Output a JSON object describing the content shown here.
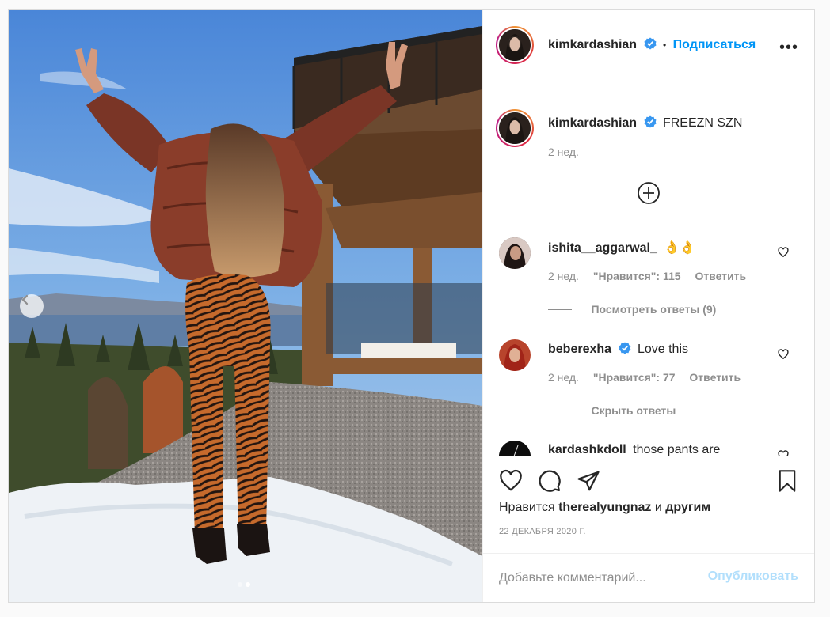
{
  "post": {
    "author": "kimkardashian",
    "follow_label": "Подписаться",
    "separator": "•",
    "more_label": "•••",
    "caption": {
      "username": "kimkardashian",
      "text": "FREEZN SZN",
      "time": "2 нед."
    },
    "load_more_icon": "plus-circle-icon",
    "comments": [
      {
        "username": "ishita__aggarwal_",
        "text": "👌👌",
        "time": "2 нед.",
        "likes_label": "\"Нравится\": 115",
        "reply_label": "Ответить",
        "replies_toggle": "Посмотреть ответы (9)"
      },
      {
        "username": "beberexha",
        "verified": true,
        "text": "Love this",
        "time": "2 нед.",
        "likes_label": "\"Нравится\": 77",
        "reply_label": "Ответить",
        "replies_toggle": "Скрыть ответы"
      },
      {
        "username": "kardashkdoll",
        "text": "those pants are"
      }
    ],
    "likes": {
      "prefix": "Нравится",
      "user": "therealyungnaz",
      "suffix": "и",
      "others": "другим"
    },
    "date": "22 ДЕКАБРЯ 2020 Г.",
    "comment_input": {
      "placeholder": "Добавьте комментарий..."
    },
    "publish_label": "Опубликовать",
    "carousel": {
      "current": 2,
      "total": 2
    }
  },
  "colors": {
    "link": "#0095f6",
    "publish_disabled": "#b2dffc",
    "secondary_text": "#8e8e8e",
    "verified": "#3897f0"
  }
}
